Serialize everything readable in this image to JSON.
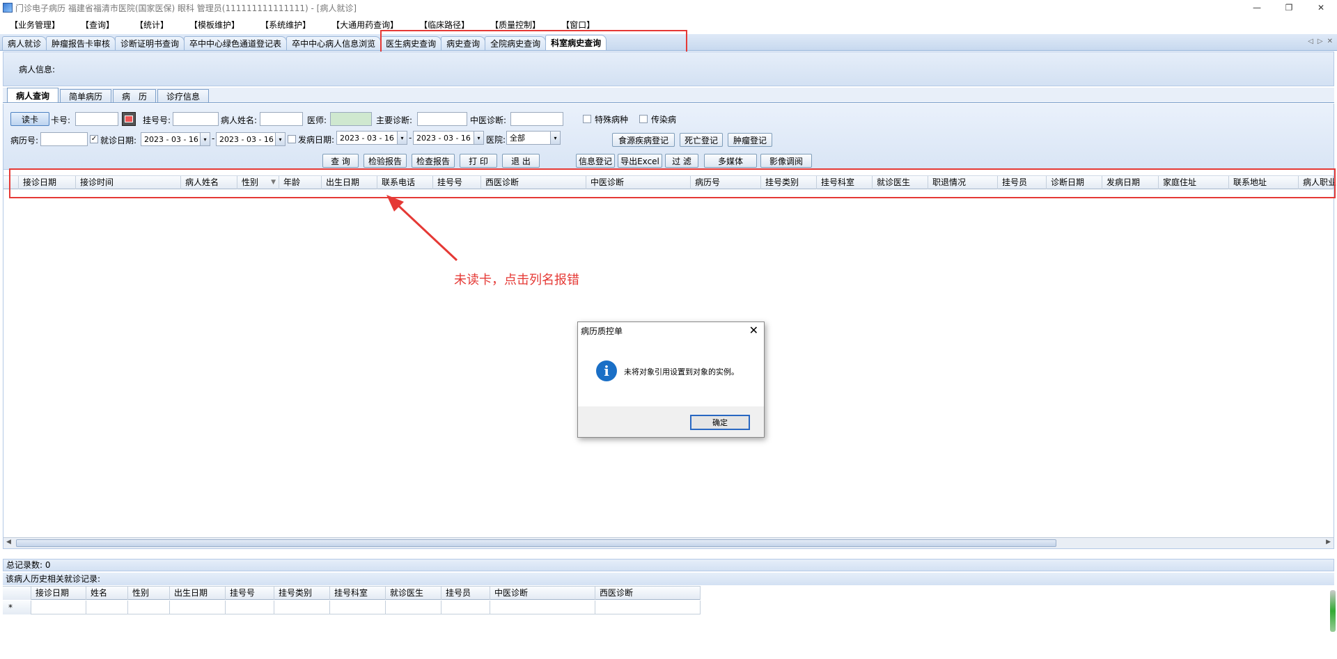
{
  "window": {
    "title": "门诊电子病历  福建省福清市医院(国家医保)  眼科  管理员(111111111111111) - [病人就诊]",
    "minimize": "—",
    "restore": "❐",
    "close": "✕"
  },
  "menu": [
    "【业务管理】",
    "【查询】",
    "【统计】",
    "【模板维护】",
    "【系统维护】",
    "【大通用药查询】",
    "【临床路径】",
    "【质量控制】",
    "【窗口】"
  ],
  "doc_tabs": [
    "病人就诊",
    "肿瘤报告卡审核",
    "诊断证明书查询",
    "卒中中心绿色通道登记表",
    "卒中中心病人信息浏览",
    "医生病史查询",
    "病史查询",
    "全院病史查询",
    "科室病史查询"
  ],
  "tab_nav": {
    "left": "◁",
    "right": "▷",
    "close": "✕"
  },
  "patient_info_label": "病人信息:",
  "sub_tabs": [
    "病人查询",
    "简单病历",
    "病　历",
    "诊疗信息"
  ],
  "filters": {
    "read_card": "读卡",
    "card_no": "卡号:",
    "reg_no": "挂号号:",
    "patient_name": "病人姓名:",
    "doctor": "医师:",
    "main_diag": "主要诊断:",
    "tcm_diag": "中医诊断:",
    "special_disease": "特殊病种",
    "infectious": "传染病",
    "record_no": "病历号:",
    "visit_date": "就诊日期:",
    "visit_from": "2023 - 03 - 16",
    "visit_to": "2023 - 03 - 16",
    "onset_date": "发病日期:",
    "onset_from": "2023 - 03 - 16",
    "onset_to": "2023 - 03 - 16",
    "dash": "-",
    "hospital": "医院:",
    "hospital_value": "全部",
    "check_mark": "✓",
    "drop_arrow": "▾"
  },
  "buttons": {
    "foodborne": "食源疾病登记",
    "death": "死亡登记",
    "tumor": "肿瘤登记",
    "query": "查 询",
    "lab_report": "检验报告",
    "exam_report": "检查报告",
    "print": "打 印",
    "exit": "退 出",
    "info_reg": "信息登记",
    "export_excel": "导出Excel",
    "filter": "过 滤",
    "multimedia": "多媒体",
    "image_view": "影像调阅"
  },
  "grid_columns": [
    "接诊日期",
    "接诊时间",
    "病人姓名",
    "性别",
    "年龄",
    "出生日期",
    "联系电话",
    "挂号号",
    "西医诊断",
    "中医诊断",
    "病历号",
    "挂号类别",
    "挂号科室",
    "就诊医生",
    "职退情况",
    "挂号员",
    "诊断日期",
    "发病日期",
    "家庭住址",
    "联系地址",
    "病人职业"
  ],
  "sort_arrow": "▼",
  "scroll": {
    "left": "◀",
    "right": "▶"
  },
  "annotation_text": "未读卡，点击列名报错",
  "status": {
    "total_records": "总记录数:  0"
  },
  "history_label": "该病人历史相关就诊记录:",
  "sub_grid_columns": [
    "接诊日期",
    "姓名",
    "性别",
    "出生日期",
    "挂号号",
    "挂号类别",
    "挂号科室",
    "就诊医生",
    "挂号员",
    "中医诊断",
    "西医诊断"
  ],
  "new_row_marker": "*",
  "dialog": {
    "title": "病历质控单",
    "close": "✕",
    "icon": "i",
    "message": "未将对象引用设置到对象的实例。",
    "ok": "确定"
  },
  "colors": {
    "annotation": "#e53935",
    "accent": "#1a6fc6"
  }
}
